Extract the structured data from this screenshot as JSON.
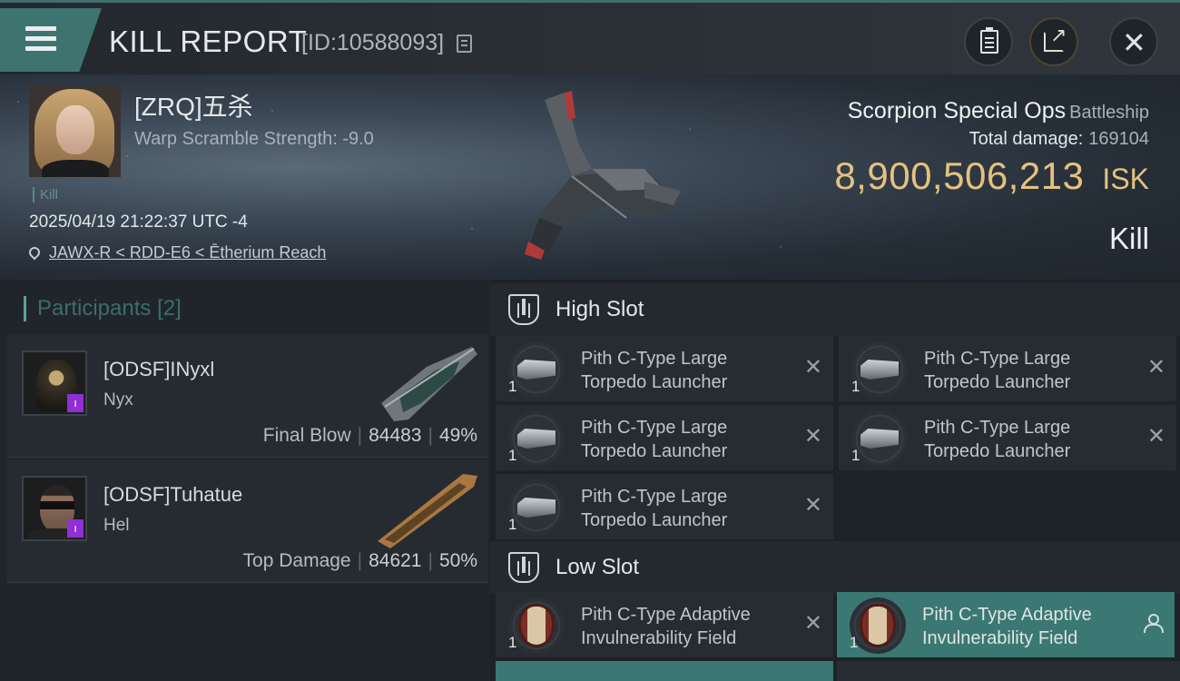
{
  "header": {
    "title": "KILL REPORT",
    "report_id": "[ID:10588093]"
  },
  "victim": {
    "name": "[ZRQ]五杀",
    "warp_scramble": "Warp Scramble Strength: -9.0",
    "tag": "Kill",
    "datetime": "2025/04/19 21:22:37 UTC -4",
    "location": "JAWX-R < RDD-E6 < Ētherium Reach"
  },
  "ship": {
    "name": "Scorpion Special Ops",
    "class": "Battleship",
    "total_damage_label": "Total damage:",
    "total_damage": "169104",
    "isk_value": "8,900,506,213",
    "isk_unit": "ISK",
    "result": "Kill"
  },
  "participants": {
    "label": "Participants",
    "count": "[2]",
    "items": [
      {
        "name": "[ODSF]INyxl",
        "ship": "Nyx",
        "role": "Final Blow",
        "damage": "84483",
        "percent": "49%"
      },
      {
        "name": "[ODSF]Tuhatue",
        "ship": "Hel",
        "role": "Top Damage",
        "damage": "84621",
        "percent": "50%"
      }
    ]
  },
  "slots": {
    "high": {
      "title": "High Slot",
      "modules": [
        {
          "qty": "1",
          "line1": "Pith C-Type Large",
          "line2": "Torpedo Launcher"
        },
        {
          "qty": "1",
          "line1": "Pith C-Type Large",
          "line2": "Torpedo Launcher"
        },
        {
          "qty": "1",
          "line1": "Pith C-Type Large",
          "line2": "Torpedo Launcher"
        },
        {
          "qty": "1",
          "line1": "Pith C-Type Large",
          "line2": "Torpedo Launcher"
        },
        {
          "qty": "1",
          "line1": "Pith C-Type Large",
          "line2": "Torpedo Launcher"
        }
      ]
    },
    "low": {
      "title": "Low Slot",
      "modules": [
        {
          "qty": "1",
          "line1": "Pith C-Type Adaptive",
          "line2": "Invulnerability Field"
        },
        {
          "qty": "1",
          "line1": "Pith C-Type Adaptive",
          "line2": "Invulnerability Field"
        }
      ]
    }
  },
  "colors": {
    "accent_teal": "#3d7470",
    "isk_gold": "#e6c17e",
    "badge_purple": "#8f2fd4"
  },
  "icons": [
    "menu-icon",
    "copy-icon",
    "clipboard-icon",
    "share-icon",
    "close-icon",
    "location-pin-icon",
    "slot-icon",
    "remove-icon",
    "person-icon"
  ]
}
